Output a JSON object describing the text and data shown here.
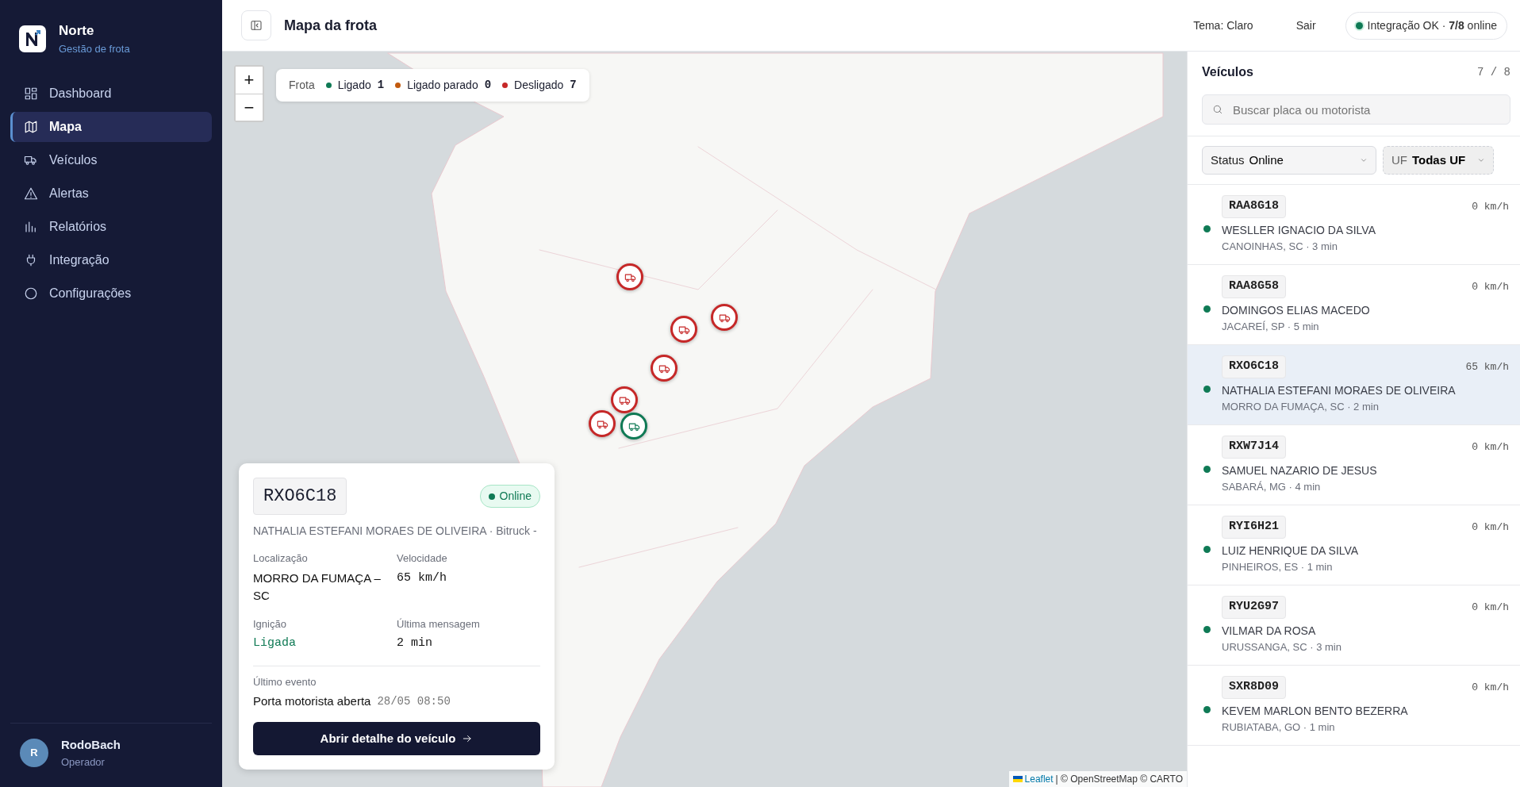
{
  "app": {
    "name": "Norte",
    "subtitle": "Gestão de frota"
  },
  "nav": [
    {
      "label": "Dashboard",
      "selected": false
    },
    {
      "label": "Mapa",
      "selected": true
    },
    {
      "label": "Veículos",
      "selected": false
    },
    {
      "label": "Alertas",
      "selected": false
    },
    {
      "label": "Relatórios",
      "selected": false
    },
    {
      "label": "Integração",
      "selected": false
    },
    {
      "label": "Configurações",
      "selected": false
    }
  ],
  "user": {
    "initial": "R",
    "name": "RodoBach",
    "role": "Operador"
  },
  "header": {
    "title": "Mapa da frota",
    "theme": "Tema: Claro",
    "logout": "Sair",
    "integration": "Integração OK · **7/8** online"
  },
  "map": {
    "zoom_in": "+",
    "zoom_out": "−",
    "legend": {
      "title": "Frota",
      "items": [
        {
          "label": "Ligado",
          "count": "1",
          "color": "#0f7a55"
        },
        {
          "label": "Ligado parado",
          "count": "0",
          "color": "#c25a0e"
        },
        {
          "label": "Desligado",
          "count": "7",
          "color": "#c62828"
        }
      ]
    },
    "markers": [
      {
        "color": "#c62828"
      },
      {
        "color": "#c62828"
      },
      {
        "color": "#c62828"
      },
      {
        "color": "#c62828"
      },
      {
        "color": "#c62828"
      },
      {
        "color": "#c62828"
      },
      {
        "color": "#0f7a55"
      }
    ],
    "attribution": {
      "link": "Leaflet",
      "text": "| © OpenStreetMap © CARTO"
    }
  },
  "detail": {
    "plate": "RXO6C18",
    "status": "Online",
    "online": true,
    "subtitle": "NATHALIA ESTEFANI MORAES DE OLIVEIRA · Bitruck -",
    "fields": [
      {
        "label": "Localização",
        "value": "MORRO DA FUMAÇA – SC",
        "kind": "text"
      },
      {
        "label": "Velocidade",
        "value": "65 km/h",
        "kind": "mono"
      },
      {
        "label": "Ignição",
        "value": "Ligada",
        "kind": "ignition"
      },
      {
        "label": "Última mensagem",
        "value": "2 min",
        "kind": "mono"
      }
    ],
    "event_label": "Último evento",
    "event": "Porta motorista aberta",
    "event_time": "28/05 08:50",
    "button": "Abrir detalhe do veículo"
  },
  "vehicles": {
    "title": "Veículos",
    "count": "7 / 8",
    "search": {
      "placeholder": "Buscar placa ou motorista"
    },
    "filters": [
      {
        "label": "Status",
        "value": "Online",
        "active": true
      },
      {
        "label": "UF",
        "value": "Todas UF",
        "active": false
      }
    ],
    "items": [
      {
        "plate": "RAA8G18",
        "speed": "0 km/h",
        "driver": "WESLLER IGNACIO DA SILVA",
        "location": "CANOINHAS, SC · 3 min",
        "online": true,
        "selected": false
      },
      {
        "plate": "RAA8G58",
        "speed": "0 km/h",
        "driver": "DOMINGOS ELIAS MACEDO",
        "location": "JACAREÍ, SP · 5 min",
        "online": true,
        "selected": false
      },
      {
        "plate": "RXO6C18",
        "speed": "65 km/h",
        "driver": "NATHALIA ESTEFANI MORAES DE OLIVEIRA",
        "location": "MORRO DA FUMAÇA, SC · 2 min",
        "online": true,
        "selected": true
      },
      {
        "plate": "RXW7J14",
        "speed": "0 km/h",
        "driver": "SAMUEL NAZARIO DE JESUS",
        "location": "SABARÁ, MG · 4 min",
        "online": true,
        "selected": false
      },
      {
        "plate": "RYI6H21",
        "speed": "0 km/h",
        "driver": "LUIZ HENRIQUE DA SILVA",
        "location": "PINHEIROS, ES · 1 min",
        "online": true,
        "selected": false
      },
      {
        "plate": "RYU2G97",
        "speed": "0 km/h",
        "driver": "VILMAR DA ROSA",
        "location": "URUSSANGA, SC · 3 min",
        "online": true,
        "selected": false
      },
      {
        "plate": "SXR8D09",
        "speed": "0 km/h",
        "driver": "KEVEM MARLON BENTO BEZERRA",
        "location": "RUBIATABA, GO · 1 min",
        "online": true,
        "selected": false
      }
    ]
  }
}
